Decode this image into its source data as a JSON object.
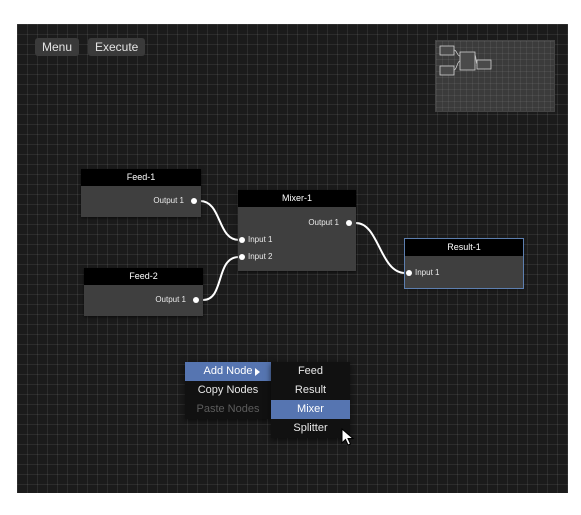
{
  "toolbar": {
    "menu_label": "Menu",
    "execute_label": "Execute"
  },
  "nodes": {
    "feed1": {
      "title": "Feed-1",
      "outputs": [
        "Output 1"
      ]
    },
    "feed2": {
      "title": "Feed-2",
      "outputs": [
        "Output 1"
      ]
    },
    "mixer1": {
      "title": "Mixer-1",
      "inputs": [
        "Input 1",
        "Input 2"
      ],
      "outputs": [
        "Output 1"
      ]
    },
    "result1": {
      "title": "Result-1",
      "inputs": [
        "Input 1"
      ]
    }
  },
  "context_menu": {
    "items": [
      "Add Node",
      "Copy Nodes",
      "Paste Nodes"
    ],
    "active_item": "Add Node",
    "disabled_item": "Paste Nodes"
  },
  "submenu": {
    "items": [
      "Feed",
      "Result",
      "Mixer",
      "Splitter"
    ],
    "highlighted_item": "Mixer"
  },
  "colors": {
    "canvas": "#1b1b1b",
    "node_body": "#3f3f3f",
    "node_title": "#000000",
    "menu_highlight": "#5675b1",
    "selection_outline": "#5d7fb0",
    "wire": "#ffffff"
  }
}
